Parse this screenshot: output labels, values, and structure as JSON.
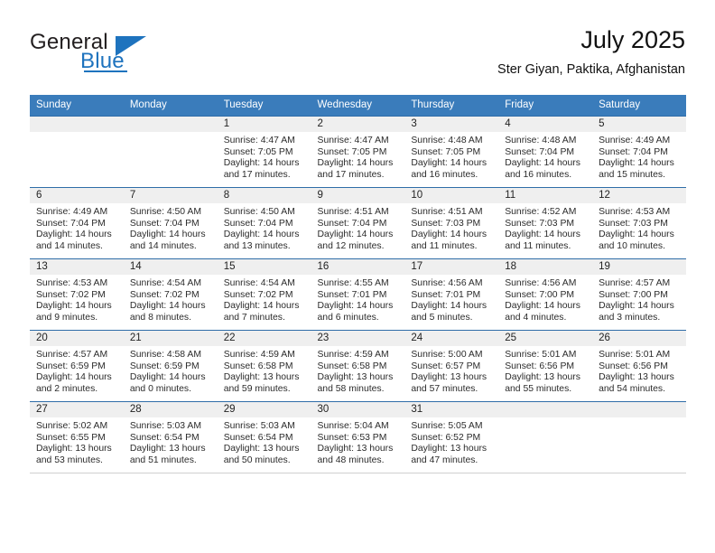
{
  "brand": {
    "name_part1": "General",
    "name_part2": "Blue"
  },
  "header": {
    "title": "July 2025",
    "location": "Ster Giyan, Paktika, Afghanistan"
  },
  "calendar": {
    "weekday_headers": [
      "Sunday",
      "Monday",
      "Tuesday",
      "Wednesday",
      "Thursday",
      "Friday",
      "Saturday"
    ],
    "colors": {
      "header_blue": "#3a7cbb",
      "row_rule_blue": "#2f6da8",
      "daynum_band": "#efefef",
      "brand_blue": "#1e73be"
    },
    "weeks": [
      [
        {
          "day": "",
          "lines": []
        },
        {
          "day": "",
          "lines": []
        },
        {
          "day": "1",
          "lines": [
            "Sunrise: 4:47 AM",
            "Sunset: 7:05 PM",
            "Daylight: 14 hours",
            "and 17 minutes."
          ]
        },
        {
          "day": "2",
          "lines": [
            "Sunrise: 4:47 AM",
            "Sunset: 7:05 PM",
            "Daylight: 14 hours",
            "and 17 minutes."
          ]
        },
        {
          "day": "3",
          "lines": [
            "Sunrise: 4:48 AM",
            "Sunset: 7:05 PM",
            "Daylight: 14 hours",
            "and 16 minutes."
          ]
        },
        {
          "day": "4",
          "lines": [
            "Sunrise: 4:48 AM",
            "Sunset: 7:04 PM",
            "Daylight: 14 hours",
            "and 16 minutes."
          ]
        },
        {
          "day": "5",
          "lines": [
            "Sunrise: 4:49 AM",
            "Sunset: 7:04 PM",
            "Daylight: 14 hours",
            "and 15 minutes."
          ]
        }
      ],
      [
        {
          "day": "6",
          "lines": [
            "Sunrise: 4:49 AM",
            "Sunset: 7:04 PM",
            "Daylight: 14 hours",
            "and 14 minutes."
          ]
        },
        {
          "day": "7",
          "lines": [
            "Sunrise: 4:50 AM",
            "Sunset: 7:04 PM",
            "Daylight: 14 hours",
            "and 14 minutes."
          ]
        },
        {
          "day": "8",
          "lines": [
            "Sunrise: 4:50 AM",
            "Sunset: 7:04 PM",
            "Daylight: 14 hours",
            "and 13 minutes."
          ]
        },
        {
          "day": "9",
          "lines": [
            "Sunrise: 4:51 AM",
            "Sunset: 7:04 PM",
            "Daylight: 14 hours",
            "and 12 minutes."
          ]
        },
        {
          "day": "10",
          "lines": [
            "Sunrise: 4:51 AM",
            "Sunset: 7:03 PM",
            "Daylight: 14 hours",
            "and 11 minutes."
          ]
        },
        {
          "day": "11",
          "lines": [
            "Sunrise: 4:52 AM",
            "Sunset: 7:03 PM",
            "Daylight: 14 hours",
            "and 11 minutes."
          ]
        },
        {
          "day": "12",
          "lines": [
            "Sunrise: 4:53 AM",
            "Sunset: 7:03 PM",
            "Daylight: 14 hours",
            "and 10 minutes."
          ]
        }
      ],
      [
        {
          "day": "13",
          "lines": [
            "Sunrise: 4:53 AM",
            "Sunset: 7:02 PM",
            "Daylight: 14 hours",
            "and 9 minutes."
          ]
        },
        {
          "day": "14",
          "lines": [
            "Sunrise: 4:54 AM",
            "Sunset: 7:02 PM",
            "Daylight: 14 hours",
            "and 8 minutes."
          ]
        },
        {
          "day": "15",
          "lines": [
            "Sunrise: 4:54 AM",
            "Sunset: 7:02 PM",
            "Daylight: 14 hours",
            "and 7 minutes."
          ]
        },
        {
          "day": "16",
          "lines": [
            "Sunrise: 4:55 AM",
            "Sunset: 7:01 PM",
            "Daylight: 14 hours",
            "and 6 minutes."
          ]
        },
        {
          "day": "17",
          "lines": [
            "Sunrise: 4:56 AM",
            "Sunset: 7:01 PM",
            "Daylight: 14 hours",
            "and 5 minutes."
          ]
        },
        {
          "day": "18",
          "lines": [
            "Sunrise: 4:56 AM",
            "Sunset: 7:00 PM",
            "Daylight: 14 hours",
            "and 4 minutes."
          ]
        },
        {
          "day": "19",
          "lines": [
            "Sunrise: 4:57 AM",
            "Sunset: 7:00 PM",
            "Daylight: 14 hours",
            "and 3 minutes."
          ]
        }
      ],
      [
        {
          "day": "20",
          "lines": [
            "Sunrise: 4:57 AM",
            "Sunset: 6:59 PM",
            "Daylight: 14 hours",
            "and 2 minutes."
          ]
        },
        {
          "day": "21",
          "lines": [
            "Sunrise: 4:58 AM",
            "Sunset: 6:59 PM",
            "Daylight: 14 hours",
            "and 0 minutes."
          ]
        },
        {
          "day": "22",
          "lines": [
            "Sunrise: 4:59 AM",
            "Sunset: 6:58 PM",
            "Daylight: 13 hours",
            "and 59 minutes."
          ]
        },
        {
          "day": "23",
          "lines": [
            "Sunrise: 4:59 AM",
            "Sunset: 6:58 PM",
            "Daylight: 13 hours",
            "and 58 minutes."
          ]
        },
        {
          "day": "24",
          "lines": [
            "Sunrise: 5:00 AM",
            "Sunset: 6:57 PM",
            "Daylight: 13 hours",
            "and 57 minutes."
          ]
        },
        {
          "day": "25",
          "lines": [
            "Sunrise: 5:01 AM",
            "Sunset: 6:56 PM",
            "Daylight: 13 hours",
            "and 55 minutes."
          ]
        },
        {
          "day": "26",
          "lines": [
            "Sunrise: 5:01 AM",
            "Sunset: 6:56 PM",
            "Daylight: 13 hours",
            "and 54 minutes."
          ]
        }
      ],
      [
        {
          "day": "27",
          "lines": [
            "Sunrise: 5:02 AM",
            "Sunset: 6:55 PM",
            "Daylight: 13 hours",
            "and 53 minutes."
          ]
        },
        {
          "day": "28",
          "lines": [
            "Sunrise: 5:03 AM",
            "Sunset: 6:54 PM",
            "Daylight: 13 hours",
            "and 51 minutes."
          ]
        },
        {
          "day": "29",
          "lines": [
            "Sunrise: 5:03 AM",
            "Sunset: 6:54 PM",
            "Daylight: 13 hours",
            "and 50 minutes."
          ]
        },
        {
          "day": "30",
          "lines": [
            "Sunrise: 5:04 AM",
            "Sunset: 6:53 PM",
            "Daylight: 13 hours",
            "and 48 minutes."
          ]
        },
        {
          "day": "31",
          "lines": [
            "Sunrise: 5:05 AM",
            "Sunset: 6:52 PM",
            "Daylight: 13 hours",
            "and 47 minutes."
          ]
        },
        {
          "day": "",
          "lines": []
        },
        {
          "day": "",
          "lines": []
        }
      ]
    ]
  }
}
